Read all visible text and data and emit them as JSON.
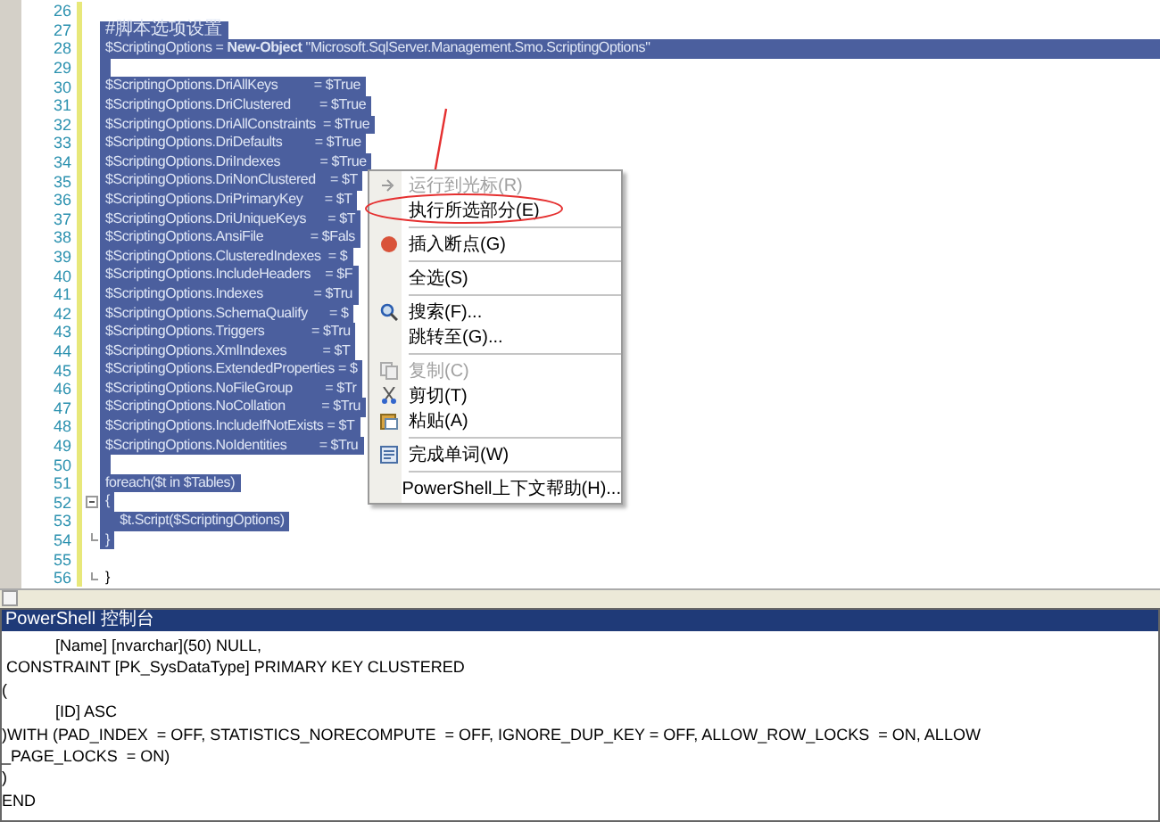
{
  "editor": {
    "lines": [
      {
        "number": "26",
        "selected": false
      },
      {
        "number": "27",
        "text": "#脚本选项设置",
        "selected": true
      },
      {
        "number": "28",
        "text": "$ScriptingOptions = **New-Object** \"Microsoft.SqlServer.Management.Smo.ScriptingOptions\"",
        "selected": true
      },
      {
        "number": "29",
        "selected": true
      },
      {
        "number": "30",
        "text": "$ScriptingOptions.DriAllKeys          = $True",
        "selected": true
      },
      {
        "number": "31",
        "text": "$ScriptingOptions.DriClustered        = $True",
        "selected": true
      },
      {
        "number": "32",
        "text": "$ScriptingOptions.DriAllConstraints  = $True",
        "selected": true
      },
      {
        "number": "33",
        "text": "$ScriptingOptions.DriDefaults         = $True",
        "selected": true
      },
      {
        "number": "34",
        "text": "$ScriptingOptions.DriIndexes           = $True",
        "selected": true
      },
      {
        "number": "35",
        "text": "$ScriptingOptions.DriNonClustered    = $T",
        "selected": true
      },
      {
        "number": "36",
        "text": "$ScriptingOptions.DriPrimaryKey      = $T",
        "selected": true
      },
      {
        "number": "37",
        "text": "$ScriptingOptions.DriUniqueKeys      = $T",
        "selected": true
      },
      {
        "number": "38",
        "text": "$ScriptingOptions.AnsiFile             = $Fals",
        "selected": true
      },
      {
        "number": "39",
        "text": "$ScriptingOptions.ClusteredIndexes  = $",
        "selected": true
      },
      {
        "number": "40",
        "text": "$ScriptingOptions.IncludeHeaders    = $F",
        "selected": true
      },
      {
        "number": "41",
        "text": "$ScriptingOptions.Indexes              = $Tru",
        "selected": true
      },
      {
        "number": "42",
        "text": "$ScriptingOptions.SchemaQualify      = $",
        "selected": true
      },
      {
        "number": "43",
        "text": "$ScriptingOptions.Triggers             = $Tru",
        "selected": true
      },
      {
        "number": "44",
        "text": "$ScriptingOptions.XmlIndexes          = $T",
        "selected": true
      },
      {
        "number": "45",
        "text": "$ScriptingOptions.ExtendedProperties = $",
        "selected": true
      },
      {
        "number": "46",
        "text": "$ScriptingOptions.NoFileGroup         = $Tr",
        "selected": true
      },
      {
        "number": "47",
        "text": "$ScriptingOptions.NoCollation          = $Tru",
        "selected": true
      },
      {
        "number": "48",
        "text": "$ScriptingOptions.IncludeIfNotExists = $T",
        "selected": true
      },
      {
        "number": "49",
        "text": "$ScriptingOptions.NoIdentities         = $Tru",
        "selected": true
      },
      {
        "number": "50",
        "selected": true
      },
      {
        "number": "51",
        "text": "foreach($t in $Tables)",
        "selected": true
      },
      {
        "number": "52",
        "text": "{",
        "selected": true
      },
      {
        "number": "53",
        "text": "    $t.Script($ScriptingOptions)",
        "selected": true
      },
      {
        "number": "54",
        "text": "}",
        "selected": true
      },
      {
        "number": "55",
        "selected": false
      },
      {
        "number": "56",
        "text": "}",
        "selected": false
      }
    ]
  },
  "context_menu": {
    "items": [
      {
        "kind": "item",
        "label": "运行到光标(R)",
        "disabled": true
      },
      {
        "kind": "item",
        "label": "执行所选部分(E)",
        "disabled": false,
        "circled": true
      },
      {
        "kind": "separator"
      },
      {
        "kind": "item",
        "label": "插入断点(G)",
        "disabled": false
      },
      {
        "kind": "separator"
      },
      {
        "kind": "item",
        "label": "全选(S)",
        "disabled": false
      },
      {
        "kind": "separator"
      },
      {
        "kind": "item",
        "label": "搜索(F)...",
        "disabled": false
      },
      {
        "kind": "item",
        "label": "跳转至(G)...",
        "disabled": false
      },
      {
        "kind": "separator"
      },
      {
        "kind": "item",
        "label": "复制(C)",
        "disabled": true
      },
      {
        "kind": "item",
        "label": "剪切(T)",
        "disabled": false
      },
      {
        "kind": "item",
        "label": "粘贴(A)",
        "disabled": false
      },
      {
        "kind": "separator"
      },
      {
        "kind": "item",
        "label": "完成单词(W)",
        "disabled": false
      },
      {
        "kind": "separator"
      },
      {
        "kind": "item",
        "label": "PowerShell上下文帮助(H)...",
        "disabled": false
      }
    ]
  },
  "console": {
    "title": "PowerShell 控制台",
    "lines": [
      "            [Name] [nvarchar](50) NULL,",
      " CONSTRAINT [PK_SysDataType] PRIMARY KEY CLUSTERED",
      "(",
      "            [ID] ASC",
      ")WITH (PAD_INDEX  = OFF, STATISTICS_NORECOMPUTE  = OFF, IGNORE_DUP_KEY = OFF, ALLOW_ROW_LOCKS  = ON, ALLOW",
      "_PAGE_LOCKS  = ON)",
      ")",
      "END"
    ]
  }
}
